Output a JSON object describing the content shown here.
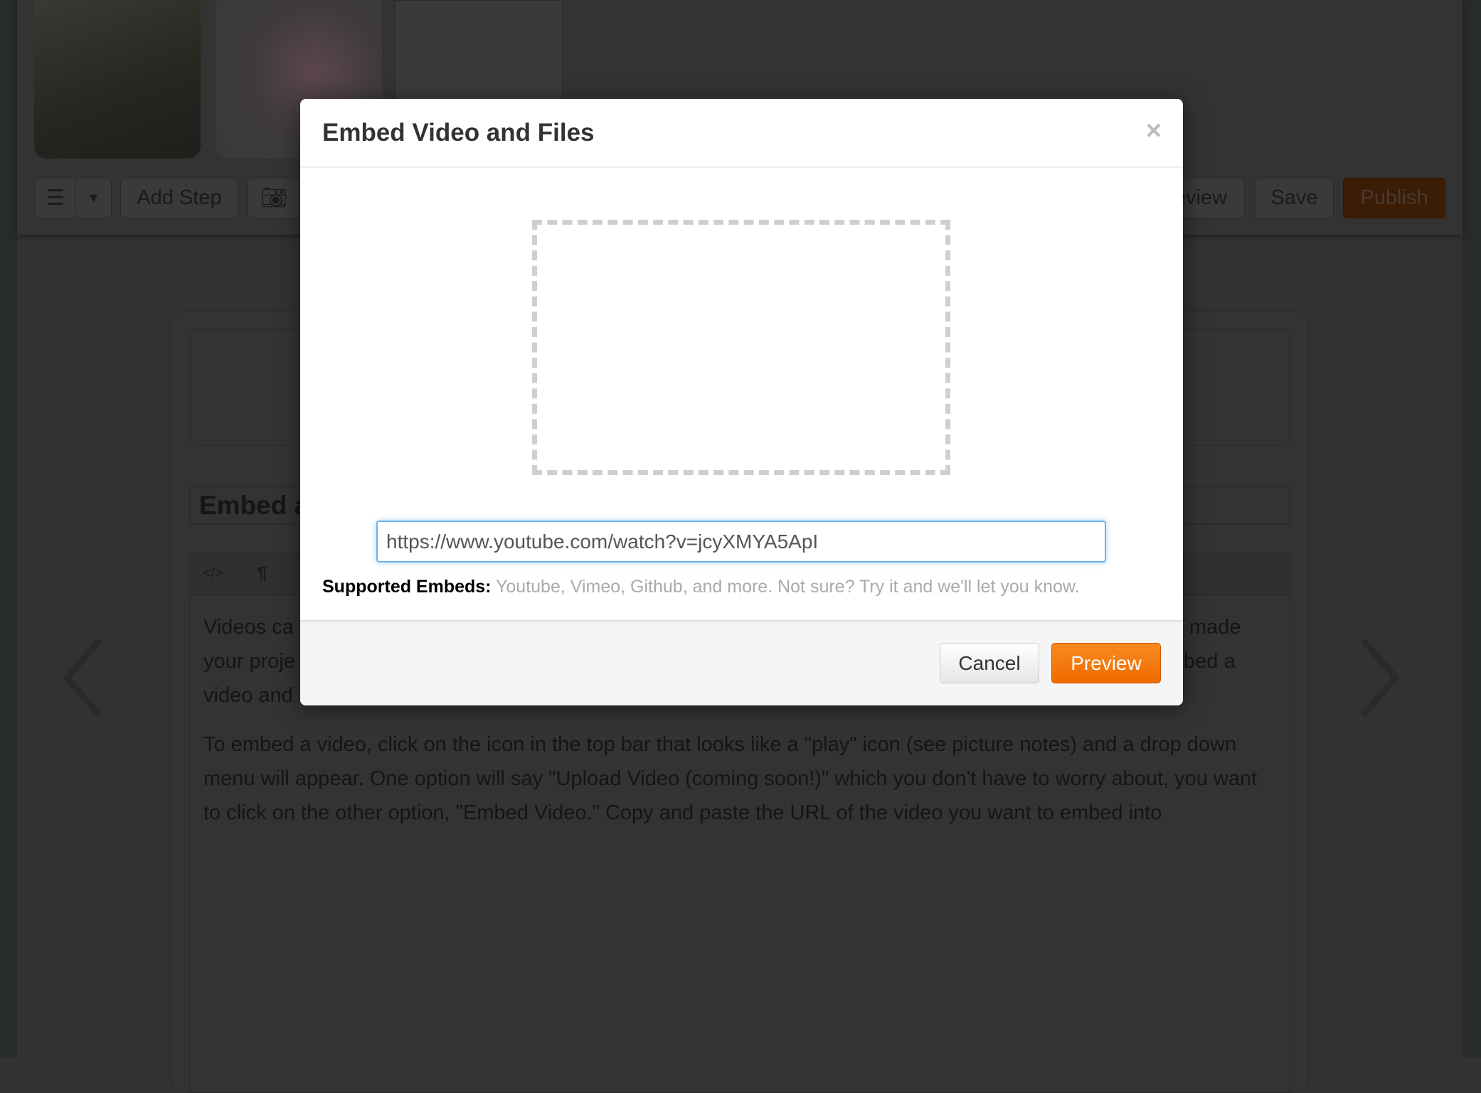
{
  "toolbar": {
    "add_step": "Add Step",
    "preview_partial": "eview",
    "save": "Save",
    "publish": "Publish",
    "icons": [
      "list-icon",
      "caret-down-icon",
      "camera-icon"
    ]
  },
  "editor": {
    "title_partial": "Embed a",
    "tools": [
      "</>",
      "¶"
    ],
    "text_left": [
      "Videos ca",
      "your proje",
      "video and"
    ],
    "text_right": [
      "made",
      "bed a",
      ""
    ],
    "paragraph2": [
      "To embed a video, click on the icon in the top bar that looks like a \"play\" icon (see picture notes) and a drop down",
      "menu will appear. One option will say \"Upload Video (coming soon!)\" which you don't have to worry about, you want",
      "to click on the other option, \"Embed Video.\" Copy and paste the URL of the video you want to embed into"
    ]
  },
  "modal": {
    "title": "Embed Video and Files",
    "close": "×",
    "url_value": "https://www.youtube.com/watch?v=jcyXMYA5ApI",
    "supported_label": "Supported Embeds:",
    "supported_text": " Youtube, Vimeo, Github, and more. Not sure? Try it and we'll let you know.",
    "cancel": "Cancel",
    "preview": "Preview"
  },
  "colors": {
    "accent": "#f07a10",
    "overlay": "#323232",
    "focus": "#6fb3e8"
  }
}
